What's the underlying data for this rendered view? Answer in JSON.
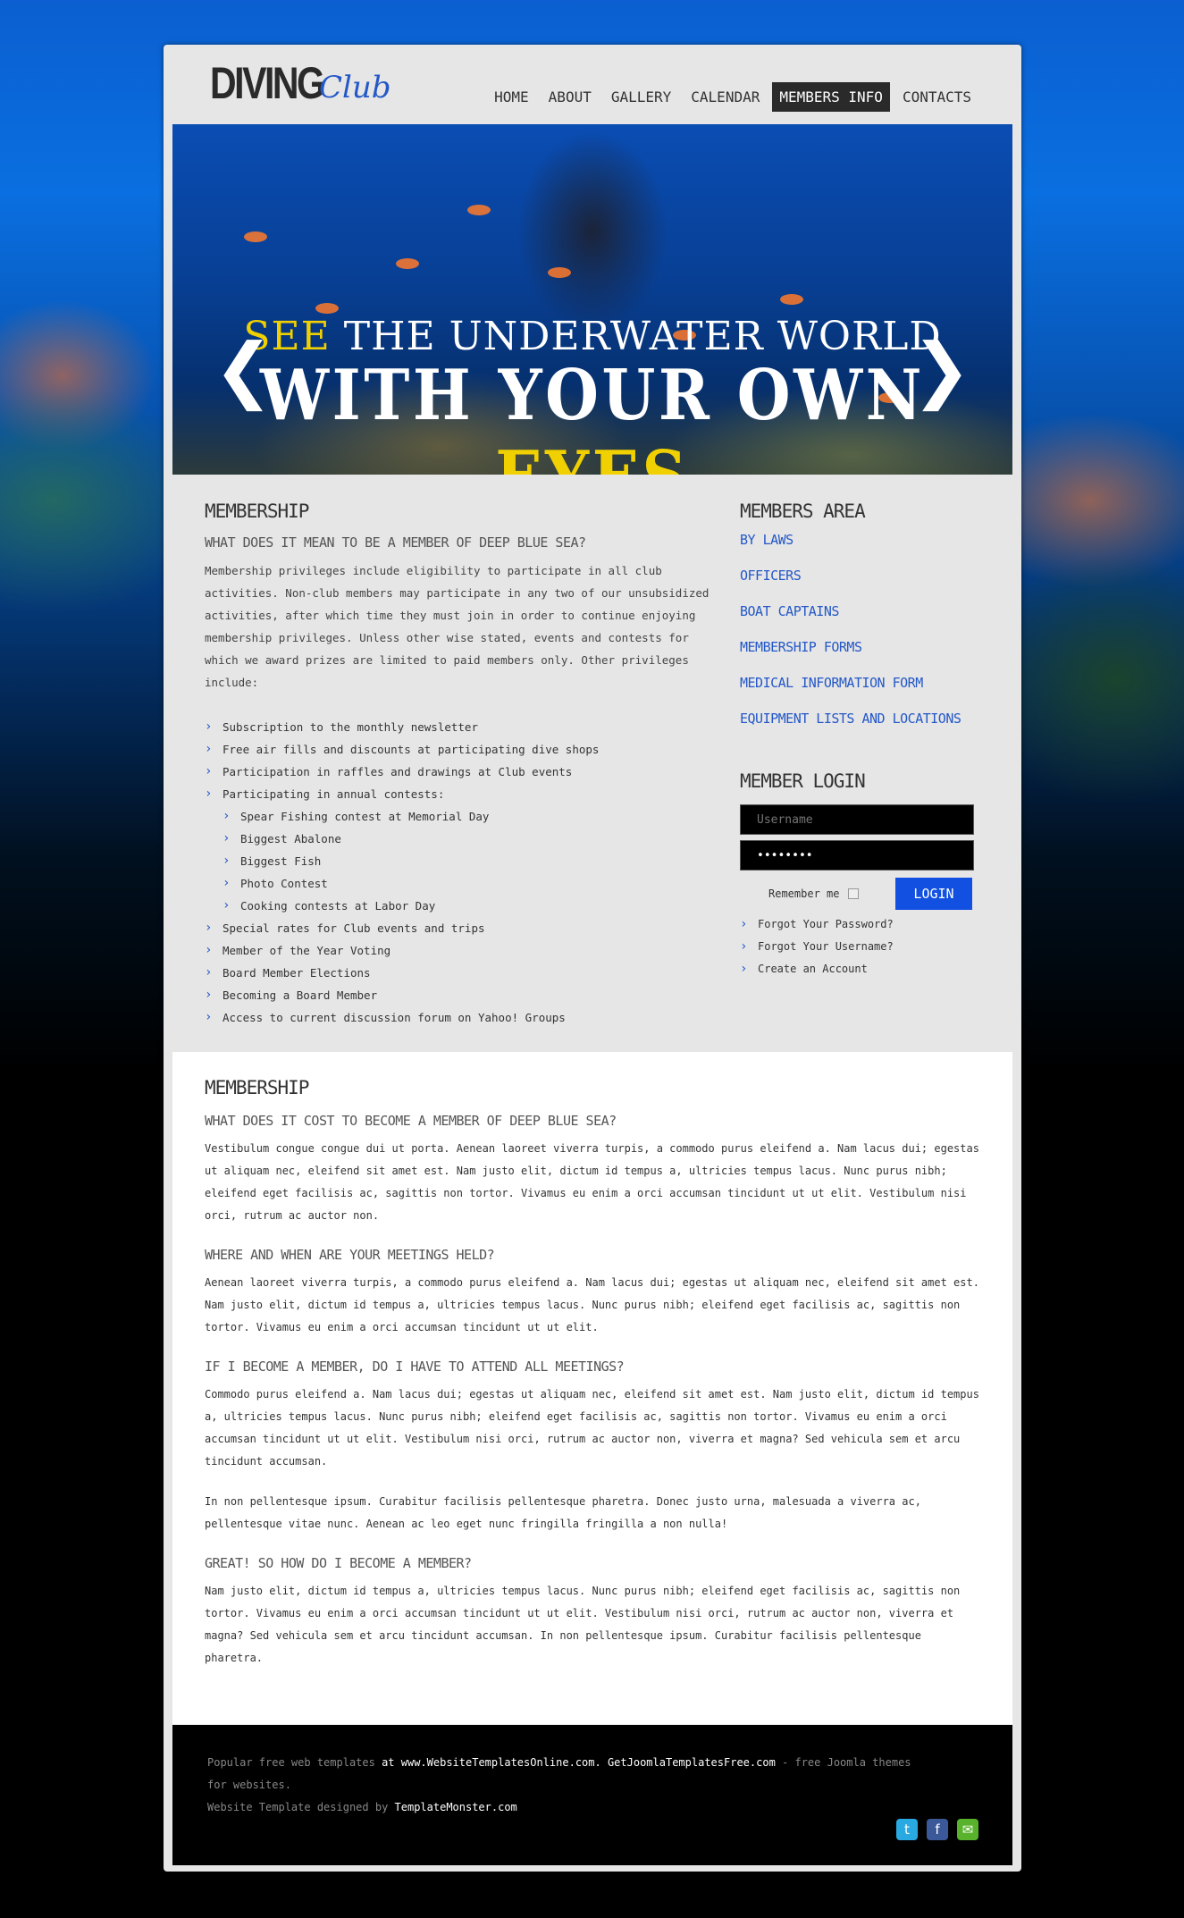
{
  "logo": {
    "main": "DIVING",
    "script": "Club"
  },
  "nav": {
    "items": [
      "HOME",
      "ABOUT",
      "GALLERY",
      "CALENDAR",
      "MEMBERS INFO",
      "CONTACTS"
    ],
    "active": "MEMBERS INFO"
  },
  "hero": {
    "line1_highlight": "SEE",
    "line1_rest": " THE UNDERWATER WORLD",
    "line2_main": "WITH YOUR OWN ",
    "line2_highlight": "EYES",
    "prev_arrow": "❮",
    "next_arrow": "❯"
  },
  "membership": {
    "title": "MEMBERSHIP",
    "subtitle": "WHAT DOES IT MEAN TO BE A MEMBER OF DEEP BLUE SEA?",
    "intro": "Membership privileges include eligibility to participate in all club activities. Non-club members may participate in any two of our unsubsidized activities, after which time they must join in order to continue enjoying membership privileges. Unless other wise stated, events and contests for which we award prizes are limited to paid members only. Other privileges include:",
    "list": [
      "Subscription to the monthly newsletter",
      "Free air fills and discounts at participating dive shops",
      "Participation in raffles and drawings at Club events",
      "Participating in annual contests:",
      "Spear Fishing contest at Memorial Day",
      "Biggest Abalone",
      "Biggest Fish",
      "Photo Contest",
      "Cooking contests at Labor Day",
      "Special rates for Club events and trips",
      "Member of the Year Voting",
      "Board Member Elections",
      "Becoming a Board Member",
      "Access to current discussion forum on Yahoo! Groups"
    ]
  },
  "members_area": {
    "title": "MEMBERS AREA",
    "links": [
      "BY LAWS",
      "OFFICERS",
      "BOAT CAPTAINS",
      "MEMBERSHIP FORMS",
      "MEDICAL INFORMATION FORM",
      "EQUIPMENT LISTS AND LOCATIONS"
    ]
  },
  "login": {
    "title": "MEMBER LOGIN",
    "username_placeholder": "Username",
    "password_value": "••••••••",
    "remember_label": "Remember me",
    "button": "LOGIN",
    "links": [
      "Forgot Your Password?",
      "Forgot Your Username?",
      "Create an Account"
    ]
  },
  "faq": {
    "title": "MEMBERSHIP",
    "sections": [
      {
        "q": "WHAT DOES IT COST TO BECOME A MEMBER OF DEEP BLUE SEA?",
        "a": [
          "Vestibulum congue congue dui ut porta. Aenean laoreet viverra turpis, a commodo purus eleifend a. Nam lacus dui; egestas ut aliquam nec, eleifend sit amet est. Nam justo elit, dictum id tempus a, ultricies tempus lacus. Nunc purus nibh; eleifend eget facilisis ac, sagittis non tortor. Vivamus eu enim a orci accumsan tincidunt ut ut elit. Vestibulum nisi orci, rutrum ac auctor non."
        ]
      },
      {
        "q": "WHERE AND WHEN ARE YOUR MEETINGS HELD?",
        "a": [
          "Aenean laoreet viverra turpis, a commodo purus eleifend a. Nam lacus dui; egestas ut aliquam nec, eleifend sit amet est. Nam justo elit, dictum id tempus a, ultricies tempus lacus. Nunc purus nibh; eleifend eget facilisis ac, sagittis non tortor. Vivamus eu enim a orci accumsan tincidunt ut ut elit."
        ]
      },
      {
        "q": "IF I BECOME A MEMBER, DO I HAVE TO ATTEND ALL MEETINGS?",
        "a": [
          "Commodo purus eleifend a. Nam lacus dui; egestas ut aliquam nec, eleifend sit amet est. Nam justo elit, dictum id tempus a, ultricies tempus lacus. Nunc purus nibh; eleifend eget facilisis ac, sagittis non tortor. Vivamus eu enim a orci accumsan tincidunt ut ut elit. Vestibulum nisi orci, rutrum ac auctor non, viverra et magna? Sed vehicula sem et arcu tincidunt accumsan.",
          "In non pellentesque ipsum. Curabitur facilisis pellentesque pharetra. Donec justo urna, malesuada a viverra ac, pellentesque vitae nunc. Aenean ac leo eget nunc fringilla fringilla a non nulla!"
        ]
      },
      {
        "q": "GREAT! SO HOW DO I BECOME A MEMBER?",
        "a": [
          "Nam justo elit, dictum id tempus a, ultricies tempus lacus. Nunc purus nibh; eleifend eget facilisis ac, sagittis non tortor. Vivamus eu enim a orci accumsan tincidunt ut ut elit. Vestibulum nisi orci, rutrum ac auctor non, viverra et magna? Sed vehicula sem et arcu tincidunt accumsan. In non pellentesque ipsum. Curabitur facilisis pellentesque pharetra."
        ]
      }
    ]
  },
  "footer": {
    "t1": "Popular free web templates",
    "t2": " at ",
    "l1": "www.WebsiteTemplatesOnline.com",
    "t3": ". ",
    "l2": "GetJoomlaTemplatesFree.com",
    "t4": " - free Joomla themes for websites.",
    "t5": "Website Template designed by ",
    "l3": "TemplateMonster.com",
    "social": [
      "twitter-icon",
      "facebook-icon",
      "chat-icon"
    ],
    "social_glyphs": [
      "t",
      "f",
      "✉"
    ],
    "social_colors": [
      "#29a9e1",
      "#3b5998",
      "#58b22b"
    ]
  },
  "colors": {
    "accent": "#2458c8",
    "highlight": "#f0d000",
    "button": "#1150e0"
  }
}
